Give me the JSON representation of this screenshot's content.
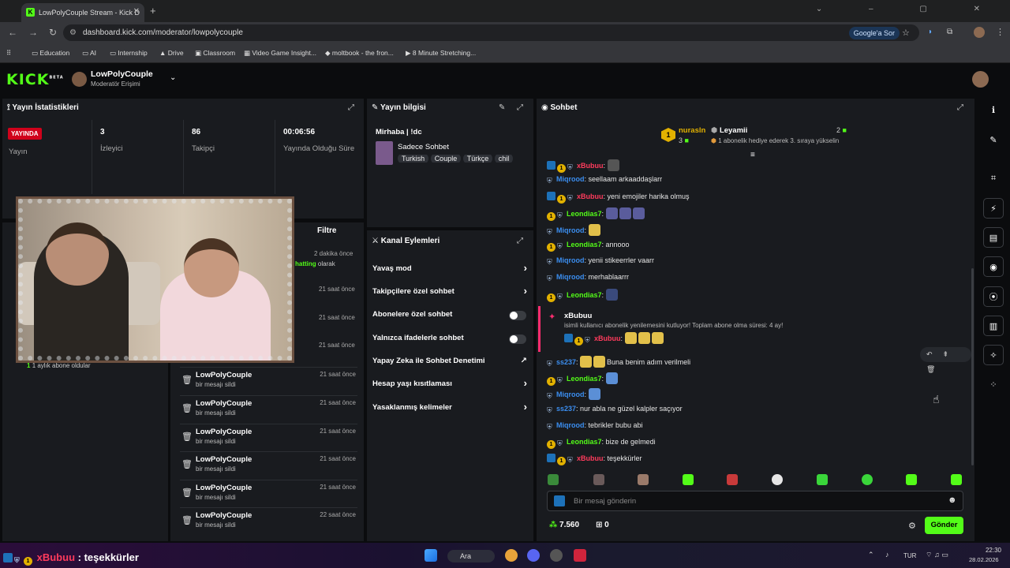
{
  "browser": {
    "tab_title": "LowPolyCouple Stream - Kick D",
    "url": "dashboard.kick.com/moderator/lowpolycouple",
    "google_btn": "Google'a Sor",
    "bookmarks": [
      "Education",
      "AI",
      "Internship",
      "Drive",
      "Classroom",
      "Video Game Insight...",
      "moltbook - the fron...",
      "8 Minute Stretching..."
    ]
  },
  "header": {
    "logo": "KICK",
    "logo_sup": "BETA",
    "channel_name": "LowPolyCouple",
    "channel_role": "Moderatör Erişimi"
  },
  "stats": {
    "title": "Yayın İstatistikleri",
    "live_badge": "YAYINDA",
    "live_label": "Yayın",
    "viewers_value": "3",
    "viewers_label": "İzleyici",
    "followers_value": "86",
    "followers_label": "Takipçi",
    "uptime_value": "00:06:56",
    "uptime_label": "Yayında Olduğu Süre"
  },
  "activity": {
    "filter_label": "Filtre",
    "subs_text": "1 aylık abone oldular",
    "subs_count": "1",
    "partial_time": "2 dakika önce",
    "partial_text_green": "hatting",
    "partial_text": "olarak",
    "faint_times": [
      "21 saat önce",
      "21 saat önce",
      "21 saat önce"
    ],
    "items": [
      {
        "name": "LowPolyCouple",
        "msg": "bir mesajı sildi",
        "time": "21 saat önce"
      },
      {
        "name": "LowPolyCouple",
        "msg": "bir mesajı sildi",
        "time": "21 saat önce"
      },
      {
        "name": "LowPolyCouple",
        "msg": "bir mesajı sildi",
        "time": "21 saat önce"
      },
      {
        "name": "LowPolyCouple",
        "msg": "bir mesajı sildi",
        "time": "21 saat önce"
      },
      {
        "name": "LowPolyCouple",
        "msg": "bir mesajı sildi",
        "time": "21 saat önce"
      },
      {
        "name": "LowPolyCouple",
        "msg": "bir mesajı sildi",
        "time": "22 saat önce"
      }
    ]
  },
  "stream_info": {
    "title": "Yayın bilgisi",
    "stream_title": "Mirhaba | !dc",
    "category": "Sadece Sohbet",
    "tags": [
      "Turkish",
      "Couple",
      "Türkçe",
      "chil"
    ]
  },
  "channel_actions": {
    "title": "Kanal Eylemleri",
    "rows": [
      {
        "label": "Yavaş mod",
        "kind": "arrow"
      },
      {
        "label": "Takipçilere özel sohbet",
        "kind": "arrow"
      },
      {
        "label": "Abonelere özel sohbet",
        "kind": "toggle"
      },
      {
        "label": "Yalnızca ifadelerle sohbet",
        "kind": "toggle"
      },
      {
        "label": "Yapay Zeka ile Sohbet Denetimi",
        "kind": "external"
      },
      {
        "label": "Hesap yaşı kısıtlaması",
        "kind": "arrow"
      },
      {
        "label": "Yasaklanmış kelimeler",
        "kind": "arrow"
      }
    ]
  },
  "chat": {
    "title": "Sohbet",
    "leader1_name": "nurasln",
    "leader1_rank": "1",
    "leader1_count": "3",
    "leader2_name": "Leyamii",
    "leader2_count": "2",
    "leader2_msg": "1 abonelik hediye ederek 3. sıraya yükselin",
    "messages": [
      {
        "user": "xBubuu",
        "color": "#ff3b5c",
        "text": ""
      },
      {
        "user": "Miqrood",
        "color": "#3b8ef0",
        "text": "seellaam arkaaddaşlarr"
      },
      {
        "user": "xBubuu",
        "color": "#ff3b5c",
        "text": "yeni emojiler harika olmuş"
      },
      {
        "user": "Leondias7",
        "color": "#53fc18",
        "text": ""
      },
      {
        "user": "Miqrood",
        "color": "#3b8ef0",
        "text": ""
      },
      {
        "user": "Leondias7",
        "color": "#53fc18",
        "text": "annooo"
      },
      {
        "user": "Miqrood",
        "color": "#3b8ef0",
        "text": "yenii stikeerrler vaarr"
      },
      {
        "user": "Miqrood",
        "color": "#3b8ef0",
        "text": "merhablaarrr"
      },
      {
        "user": "Leondias7",
        "color": "#53fc18",
        "text": ""
      }
    ],
    "sub_user": "xBubuu",
    "sub_text": "isimli kullanıcı abonelik yenilemesini kutluyor! Toplam abone olma süresi: 4 ay!",
    "sub_inner_user": "xBubuu",
    "messages2": [
      {
        "user": "ss237",
        "color": "#3b8ef0",
        "text": "Buna benim adım verilmeli"
      },
      {
        "user": "Leondias7",
        "color": "#53fc18",
        "text": ""
      },
      {
        "user": "Miqrood",
        "color": "#3b8ef0",
        "text": ""
      },
      {
        "user": "ss237",
        "color": "#3b8ef0",
        "text": "nur abla ne güzel kalpler saçıyor"
      },
      {
        "user": "Miqrood",
        "color": "#3b8ef0",
        "text": "tebrikler bubu abi"
      },
      {
        "user": "Leondias7",
        "color": "#53fc18",
        "text": "bize de gelmedi"
      },
      {
        "user": "xBubuu",
        "color": "#ff3b5c",
        "text": "teşekkürler"
      }
    ],
    "input_placeholder": "Bir mesaj gönderin",
    "points": "7.560",
    "gifts": "0",
    "send_label": "Gönder"
  },
  "taskbar": {
    "overlay_user": "xBubuu",
    "overlay_text": "teşekkürler",
    "search_label": "Ara",
    "lang": "TUR",
    "time": "22:30",
    "date": "28.02.2026"
  },
  "colors": {
    "kick_green": "#53fc18",
    "panel_bg": "#191b1f",
    "live_red": "#d0021b"
  }
}
